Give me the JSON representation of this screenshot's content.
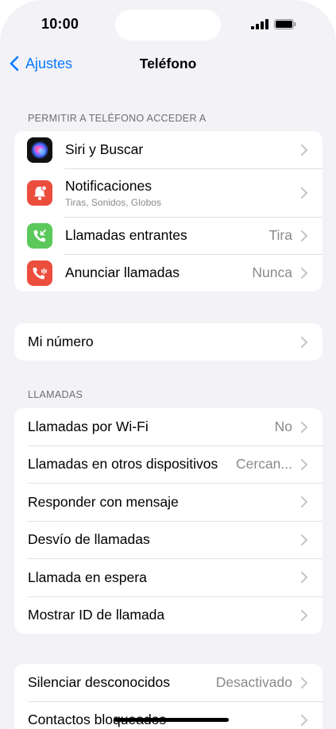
{
  "status_bar": {
    "time": "10:00"
  },
  "nav": {
    "back_label": "Ajustes",
    "title": "Teléfono"
  },
  "section_access": {
    "header": "PERMITIR A TELÉFONO ACCEDER A",
    "items": [
      {
        "label": "Siri y Buscar",
        "icon": "siri-icon"
      },
      {
        "label": "Notificaciones",
        "subtitle": "Tiras, Sonidos, Globos",
        "icon": "notifications-icon",
        "color": "#eb4e3d"
      },
      {
        "label": "Llamadas entrantes",
        "value": "Tira",
        "icon": "incoming-call-icon",
        "color": "#5ac85a"
      },
      {
        "label": "Anunciar llamadas",
        "value": "Nunca",
        "icon": "announce-calls-icon",
        "color": "#eb4e3d"
      }
    ]
  },
  "my_number": {
    "label": "Mi número"
  },
  "section_calls": {
    "header": "LLAMADAS",
    "items": [
      {
        "label": "Llamadas por Wi-Fi",
        "value": "No"
      },
      {
        "label": "Llamadas en otros dispositivos",
        "value": "Cercan..."
      },
      {
        "label": "Responder con mensaje"
      },
      {
        "label": "Desvío de llamadas"
      },
      {
        "label": "Llamada en espera"
      },
      {
        "label": "Mostrar ID de llamada"
      }
    ]
  },
  "section_block": {
    "items": [
      {
        "label": "Silenciar desconocidos",
        "value": "Desactivado"
      },
      {
        "label": "Contactos bloqueados"
      }
    ]
  },
  "colors": {
    "accent": "#0a7aff",
    "background": "#f2f2f7"
  }
}
